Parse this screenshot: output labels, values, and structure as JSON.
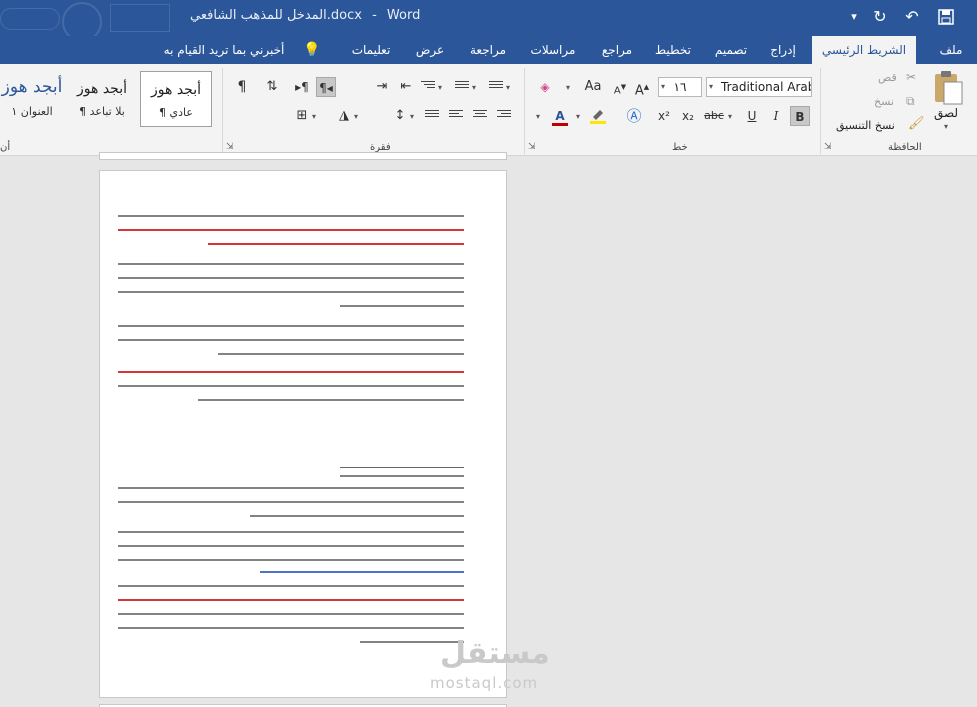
{
  "title_bar": {
    "doc_title": "المدخل للمذهب الشافعي.docx",
    "app_name": "Word",
    "separator": "-",
    "bg_color": "#2b579a"
  },
  "tabs": [
    {
      "label": "ملف"
    },
    {
      "label": "الشريط الرئيسي",
      "active": true
    },
    {
      "label": "إدراج"
    },
    {
      "label": "تصميم"
    },
    {
      "label": "تخطيط"
    },
    {
      "label": "مراجع"
    },
    {
      "label": "مراسلات"
    },
    {
      "label": "مراجعة"
    },
    {
      "label": "عرض"
    },
    {
      "label": "تعليمات"
    }
  ],
  "tell_me": "أخبرني بما تريد القيام به",
  "clipboard": {
    "paste": "لصق",
    "cut": "قص",
    "copy": "نسخ",
    "format_painter": "نسخ التنسيق",
    "group_label": "الحافظة"
  },
  "font": {
    "font_name": "Traditional Arabic",
    "font_size": "١٦",
    "group_label": "خط",
    "bold": "B",
    "italic": "I",
    "underline": "U",
    "strike": "abc",
    "subscript": "x₂",
    "superscript": "x²",
    "change_case": "Aa",
    "grow": "A",
    "shrink": "A",
    "color_letter": "A"
  },
  "paragraph": {
    "group_label": "فقرة",
    "pilcrow": "¶"
  },
  "styles": {
    "items": [
      {
        "preview": "أبجد هوز",
        "name": "¶ عادي"
      },
      {
        "preview": "أبجد هوز",
        "name": "¶ بلا تباعد"
      },
      {
        "preview": "أبجد هوز",
        "name": "العنوان ١"
      }
    ],
    "partial_label": "أن"
  },
  "watermark": {
    "arabic": "مستقل",
    "latin": "mostaql.com"
  },
  "colors": {
    "accent": "#2b579a",
    "highlight_yellow": "#ffe600",
    "font_red": "#c00000"
  }
}
